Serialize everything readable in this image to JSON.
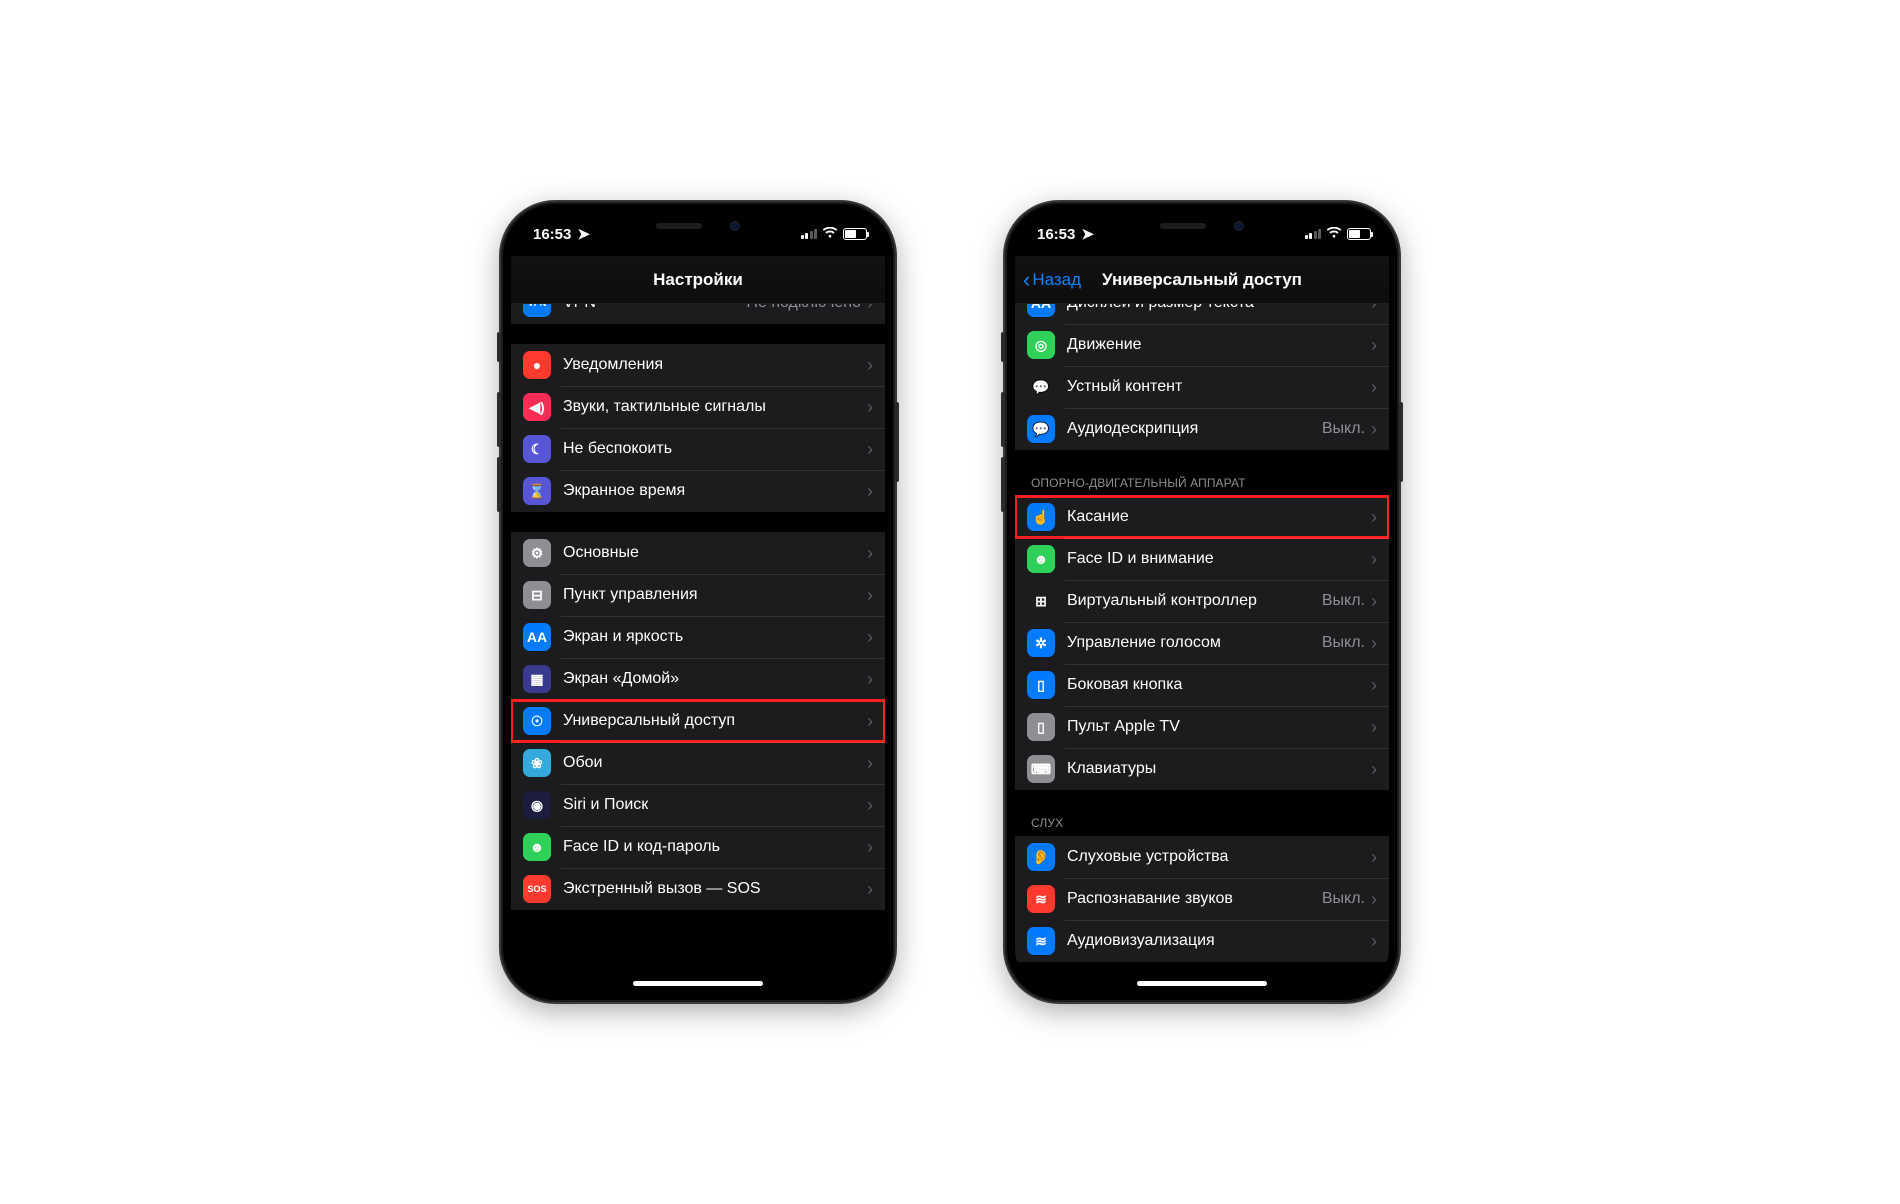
{
  "statusTime": "16:53",
  "phone1": {
    "title": "Настройки",
    "sections": [
      {
        "header": null,
        "partialTop": true,
        "rows": [
          {
            "icon": "vpn-icon",
            "iconBg": "#007aff",
            "iconText": "VPN",
            "label": "VPN",
            "value": "Не подключено",
            "highlight": false
          }
        ]
      },
      {
        "header": null,
        "rows": [
          {
            "icon": "notifications-icon",
            "iconBg": "#ff3b30",
            "iconText": "●",
            "label": "Уведомления",
            "value": "",
            "highlight": false
          },
          {
            "icon": "sounds-icon",
            "iconBg": "#ff2d55",
            "iconText": "◀)",
            "label": "Звуки, тактильные сигналы",
            "value": "",
            "highlight": false
          },
          {
            "icon": "dnd-icon",
            "iconBg": "#5856d6",
            "iconText": "☾",
            "label": "Не беспокоить",
            "value": "",
            "highlight": false
          },
          {
            "icon": "screentime-icon",
            "iconBg": "#5856d6",
            "iconText": "⌛",
            "label": "Экранное время",
            "value": "",
            "highlight": false
          }
        ]
      },
      {
        "header": null,
        "rows": [
          {
            "icon": "general-icon",
            "iconBg": "#8e8e93",
            "iconText": "⚙",
            "label": "Основные",
            "value": "",
            "highlight": false
          },
          {
            "icon": "controlcenter-icon",
            "iconBg": "#8e8e93",
            "iconText": "⊟",
            "label": "Пункт управления",
            "value": "",
            "highlight": false
          },
          {
            "icon": "display-icon",
            "iconBg": "#007aff",
            "iconText": "AA",
            "label": "Экран и яркость",
            "value": "",
            "highlight": false
          },
          {
            "icon": "homescreen-icon",
            "iconBg": "#3a3a8f",
            "iconText": "▦",
            "label": "Экран «Домой»",
            "value": "",
            "highlight": false
          },
          {
            "icon": "accessibility-icon",
            "iconBg": "#007aff",
            "iconText": "☉",
            "label": "Универсальный доступ",
            "value": "",
            "highlight": true
          },
          {
            "icon": "wallpaper-icon",
            "iconBg": "#34aadc",
            "iconText": "❀",
            "label": "Обои",
            "value": "",
            "highlight": false
          },
          {
            "icon": "siri-icon",
            "iconBg": "#1c1c40",
            "iconText": "◉",
            "label": "Siri и Поиск",
            "value": "",
            "highlight": false
          },
          {
            "icon": "faceid-icon",
            "iconBg": "#30d158",
            "iconText": "☻",
            "label": "Face ID и код-пароль",
            "value": "",
            "highlight": false
          },
          {
            "icon": "sos-icon",
            "iconBg": "#ff3b30",
            "iconText": "SOS",
            "label": "Экстренный вызов — SOS",
            "value": "",
            "highlight": false
          }
        ]
      }
    ]
  },
  "phone2": {
    "backLabel": "Назад",
    "title": "Универсальный доступ",
    "sections": [
      {
        "header": null,
        "partialTop": true,
        "rows": [
          {
            "icon": "textsize-icon",
            "iconBg": "#007aff",
            "iconText": "AA",
            "label": "Дисплей и размер текста",
            "value": "",
            "highlight": false
          },
          {
            "icon": "motion-icon",
            "iconBg": "#30d158",
            "iconText": "◎",
            "label": "Движение",
            "value": "",
            "highlight": false
          },
          {
            "icon": "spoken-icon",
            "iconBg": "#1c1c1e",
            "iconText": "💬",
            "label": "Устный контент",
            "value": "",
            "highlight": false
          },
          {
            "icon": "audiodesc-icon",
            "iconBg": "#007aff",
            "iconText": "💬",
            "label": "Аудиодескрипция",
            "value": "Выкл.",
            "highlight": false
          }
        ]
      },
      {
        "header": "ОПОРНО-ДВИГАТЕЛЬНЫЙ АППАРАТ",
        "rows": [
          {
            "icon": "touch-icon",
            "iconBg": "#007aff",
            "iconText": "☝",
            "label": "Касание",
            "value": "",
            "highlight": true
          },
          {
            "icon": "faceid-att-icon",
            "iconBg": "#30d158",
            "iconText": "☻",
            "label": "Face ID и внимание",
            "value": "",
            "highlight": false
          },
          {
            "icon": "switch-icon",
            "iconBg": "#1c1c1e",
            "iconText": "⊞",
            "label": "Виртуальный контроллер",
            "value": "Выкл.",
            "highlight": false
          },
          {
            "icon": "voicecontrol-icon",
            "iconBg": "#007aff",
            "iconText": "✲",
            "label": "Управление голосом",
            "value": "Выкл.",
            "highlight": false
          },
          {
            "icon": "sidebutton-icon",
            "iconBg": "#007aff",
            "iconText": "▯",
            "label": "Боковая кнопка",
            "value": "",
            "highlight": false
          },
          {
            "icon": "appletv-icon",
            "iconBg": "#8e8e93",
            "iconText": "▯",
            "label": "Пульт Apple TV",
            "value": "",
            "highlight": false
          },
          {
            "icon": "keyboards-icon",
            "iconBg": "#8e8e93",
            "iconText": "⌨",
            "label": "Клавиатуры",
            "value": "",
            "highlight": false
          }
        ]
      },
      {
        "header": "СЛУХ",
        "rows": [
          {
            "icon": "hearing-icon",
            "iconBg": "#007aff",
            "iconText": "👂",
            "label": "Слуховые устройства",
            "value": "",
            "highlight": false
          },
          {
            "icon": "soundrec-icon",
            "iconBg": "#ff3b30",
            "iconText": "≋",
            "label": "Распознавание звуков",
            "value": "Выкл.",
            "highlight": false
          },
          {
            "icon": "audio-icon",
            "iconBg": "#007aff",
            "iconText": "≋",
            "label": "Аудиовизуализация",
            "value": "",
            "highlight": false
          }
        ]
      }
    ]
  }
}
